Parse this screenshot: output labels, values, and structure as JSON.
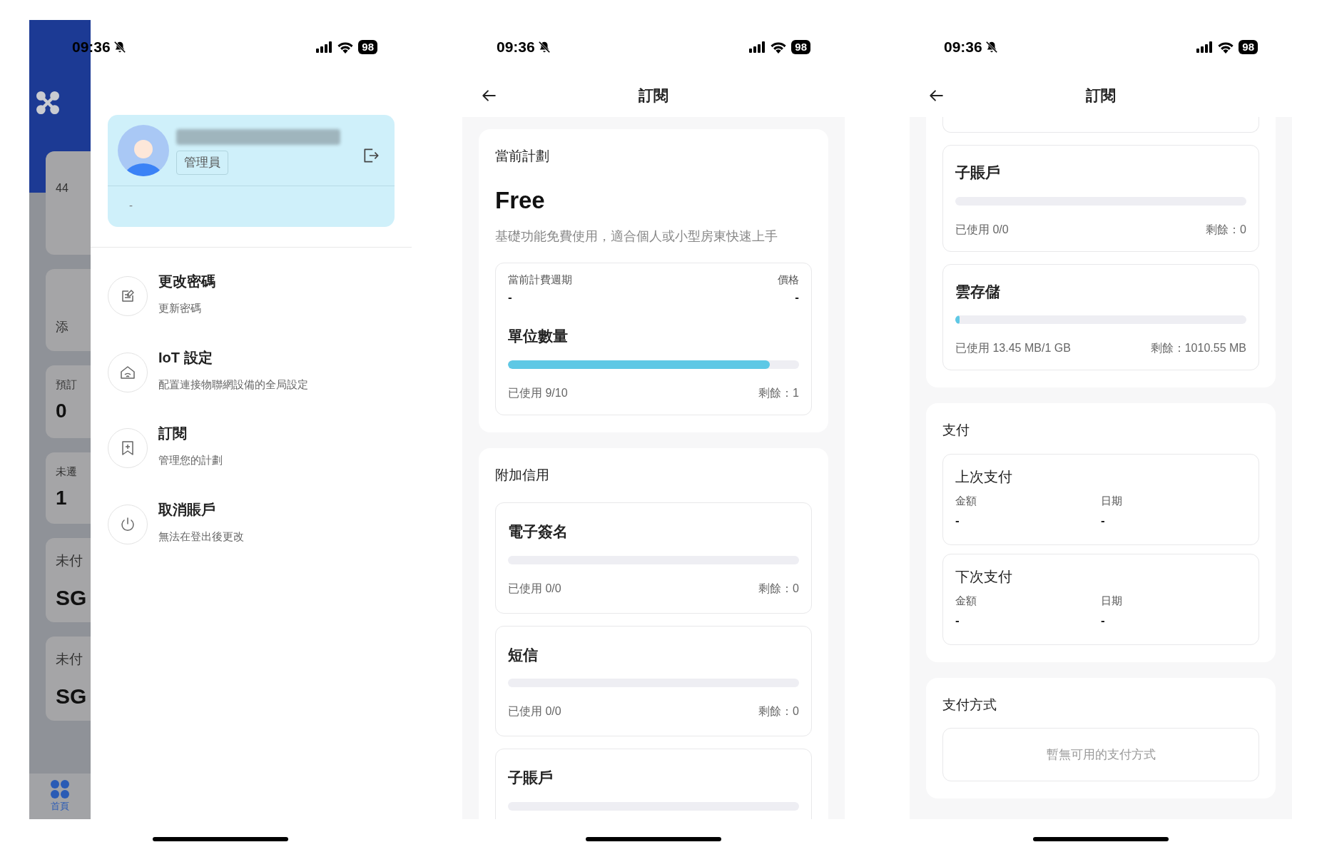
{
  "menu_screen": {
    "status_bar": {
      "time": "09:36",
      "battery": "98"
    },
    "background_app": {
      "texts": {
        "card_1": "44",
        "card_2": "添",
        "card_3_label": "預訂",
        "card_3_value": "0",
        "card_4_label": "未遷",
        "card_4_value": "1",
        "card_5_label": "未付",
        "card_5_value": "SG",
        "card_6_label": "未付",
        "card_6_value": "SG"
      },
      "tab": {
        "label": "首頁",
        "selected": true
      }
    },
    "profile": {
      "role": "管理員",
      "detail": "-"
    },
    "menu_items": [
      {
        "kind": "password",
        "title": "更改密碼",
        "subtitle": "更新密碼"
      },
      {
        "kind": "iot",
        "title": "IoT 設定",
        "subtitle": "配置連接物聯網設備的全局設定"
      },
      {
        "kind": "subscription",
        "title": "訂閱",
        "subtitle": "管理您的計劃"
      },
      {
        "kind": "cancel",
        "title": "取消賬戶",
        "subtitle": "無法在登出後更改"
      }
    ]
  },
  "subscription_screen_top": {
    "status_bar": {
      "time": "09:36",
      "battery": "98"
    },
    "title": "訂閱",
    "current_plan": {
      "heading": "當前計劃",
      "name": "Free",
      "description": "基礎功能免費使用，適合個人或小型房東快速上手",
      "billing_period_label": "當前計費週期",
      "billing_period": "-",
      "price_label": "價格",
      "price": "-",
      "units": {
        "title": "單位數量",
        "level": 0.9,
        "used": "已使用 9/10",
        "remaining": "剩餘：1"
      }
    },
    "add_on_credits": {
      "heading": "附加信用",
      "items": [
        {
          "title": "電子簽名",
          "level": 0,
          "used": "已使用 0/0",
          "remaining": "剩餘：0"
        },
        {
          "title": "短信",
          "level": 0,
          "used": "已使用 0/0",
          "remaining": "剩餘：0"
        },
        {
          "title": "子賬戶",
          "level": 0
        }
      ]
    }
  },
  "subscription_screen_bottom": {
    "status_bar": {
      "time": "09:36",
      "battery": "98"
    },
    "title": "訂閱",
    "add_on_credits": {
      "items": [
        {
          "title": "子賬戶",
          "level": 0,
          "used": "已使用 0/0",
          "remaining": "剩餘：0"
        },
        {
          "title": "雲存儲",
          "level": 0.013,
          "used": "已使用 13.45 MB/1 GB",
          "remaining": "剩餘：1010.55 MB"
        }
      ]
    },
    "payment": {
      "heading": "支付",
      "blocks": [
        {
          "title": "上次支付",
          "amount_label": "金額",
          "amount": "-",
          "date_label": "日期",
          "date": "-"
        },
        {
          "title": "下次支付",
          "amount_label": "金額",
          "amount": "-",
          "date_label": "日期",
          "date": "-"
        }
      ]
    },
    "payment_methods": {
      "heading": "支付方式",
      "empty_message": "暫無可用的支付方式"
    }
  }
}
